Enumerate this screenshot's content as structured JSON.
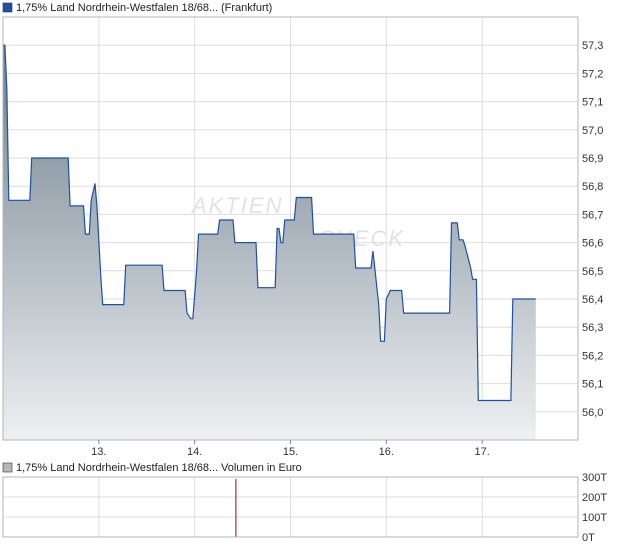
{
  "colors": {
    "price_line": "#1f4fa8",
    "area_top": "#6e7f8c",
    "area_bottom": "#eef0f2",
    "grid": "#dedede",
    "frame": "#b4b4b4",
    "volume_bar": "#b03030",
    "legend_price_swatch": "#1f4fa8",
    "legend_volume_swatch": "#b8b8b8"
  },
  "watermark": {
    "line1": "AKTIEN",
    "line2": "CHECK"
  },
  "chart_data": [
    {
      "type": "area",
      "legend": [
        "1,75% Land Nordrhein-Westfalen 18/68...",
        "(Frankfurt)"
      ],
      "x_ticks": [
        "13.",
        "14.",
        "15.",
        "16.",
        "17."
      ],
      "x_tick_pos": [
        1.0,
        2.0,
        3.0,
        4.0,
        5.0
      ],
      "y_ticks": [
        "57,3",
        "57,2",
        "57,1",
        "57,0",
        "56,9",
        "56,8",
        "56,7",
        "56,6",
        "56,5",
        "56,4",
        "56,3",
        "56,2",
        "56,1",
        "56,0"
      ],
      "ylim": [
        55.9,
        57.4
      ],
      "xlim": [
        0,
        6.0
      ],
      "grid": true,
      "series": [
        {
          "x": [
            0.0,
            0.02,
            0.04,
            0.06,
            0.08,
            0.28,
            0.3,
            0.68,
            0.7,
            0.84,
            0.86,
            0.9,
            0.92,
            0.96,
            0.98,
            1.02,
            1.04,
            1.06,
            1.08,
            1.26,
            1.28,
            1.66,
            1.68,
            1.9,
            1.92,
            1.96,
            1.98,
            2.02,
            2.04,
            2.24,
            2.26,
            2.4,
            2.42,
            2.64,
            2.66,
            2.7,
            2.72,
            2.84,
            2.86,
            2.88,
            2.9,
            2.92,
            2.94,
            3.04,
            3.06,
            3.22,
            3.24,
            3.36,
            3.38,
            3.66,
            3.68,
            3.82,
            3.84,
            3.86,
            3.88,
            3.92,
            3.94,
            3.98,
            4.0,
            4.04,
            4.06,
            4.16,
            4.18,
            4.52,
            4.54,
            4.66,
            4.68,
            4.74,
            4.76,
            4.8,
            4.82,
            4.88,
            4.9,
            4.94,
            4.96,
            5.12,
            5.14,
            5.3,
            5.32,
            5.56
          ],
          "values": [
            57.3,
            57.3,
            57.15,
            56.75,
            56.75,
            56.75,
            56.9,
            56.9,
            56.73,
            56.73,
            56.63,
            56.63,
            56.75,
            56.81,
            56.73,
            56.48,
            56.38,
            56.38,
            56.38,
            56.38,
            56.52,
            56.52,
            56.43,
            56.43,
            56.35,
            56.33,
            56.33,
            56.5,
            56.63,
            56.63,
            56.68,
            56.68,
            56.6,
            56.6,
            56.44,
            56.44,
            56.44,
            56.44,
            56.65,
            56.65,
            56.6,
            56.6,
            56.68,
            56.68,
            56.76,
            56.76,
            56.63,
            56.63,
            56.63,
            56.63,
            56.51,
            56.51,
            56.51,
            56.57,
            56.51,
            56.38,
            56.25,
            56.25,
            56.4,
            56.43,
            56.43,
            56.43,
            56.35,
            56.35,
            56.35,
            56.35,
            56.67,
            56.67,
            56.61,
            56.61,
            56.59,
            56.51,
            56.47,
            56.47,
            56.04,
            56.04,
            56.04,
            56.04,
            56.4,
            56.4
          ]
        }
      ]
    },
    {
      "type": "bar",
      "legend": [
        "1,75% Land Nordrhein-Westfalen 18/68...",
        "Volumen in Euro"
      ],
      "y_ticks": [
        "300T",
        "200T",
        "100T",
        "0T"
      ],
      "ylim": [
        0,
        300
      ],
      "xlim": [
        0,
        6.0
      ],
      "grid": true,
      "series": [
        {
          "x": [
            2.43
          ],
          "values": [
            290
          ]
        }
      ]
    }
  ]
}
